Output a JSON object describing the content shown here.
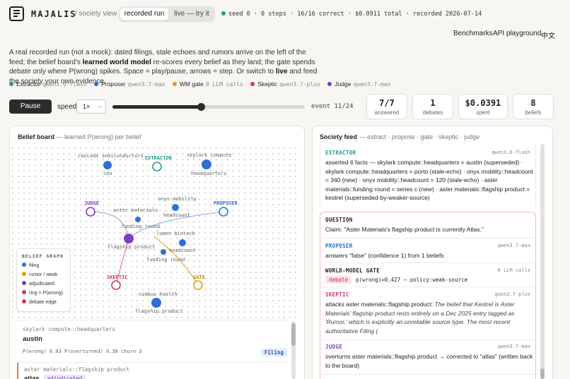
{
  "header": {
    "brand": "MAJALIS",
    "crumb": "/ society view",
    "mode_recorded": "recorded run",
    "mode_live": "live — try it",
    "status": "seed 0 · 0 steps · 16/16 correct · $0.0911 total · recorded 2026-07-14",
    "nav": [
      "Benchmarks",
      "API playground",
      "中文"
    ]
  },
  "intro": {
    "p1": "A real recorded run (not a mock): dated filings, stale echoes and rumors arrive on the left of the feed; the belief board's ",
    "b1": "learned world model",
    "p2": " re-scores every belief as they land; the gate spends debate only where P(wrong) spikes. Space = play/pause, arrows = step. Or switch to ",
    "b2": "live",
    "p3": " and feed the society your own evidence."
  },
  "agents": [
    {
      "name": "Extractor",
      "model": "qwen3.6-flash",
      "color": "#1f9e8f"
    },
    {
      "name": "Proposer",
      "model": "qwen3.7-max",
      "color": "#2f6fd6"
    },
    {
      "name": "WM gate",
      "model": "0 LLM calls",
      "color": "#e0a000"
    },
    {
      "name": "Skeptic",
      "model": "qwen3.7-plus",
      "color": "#d23b5a"
    },
    {
      "name": "Judge",
      "model": "qwen3.7-max",
      "color": "#7b3fc4"
    }
  ],
  "controls": {
    "pause_label": "Pause",
    "speed_label": "speed",
    "speed_value": "1×",
    "event_label": "event 11/24",
    "progress": 0.458
  },
  "stats": [
    {
      "value": "7/7",
      "label": "answered"
    },
    {
      "value": "1",
      "label": "debates"
    },
    {
      "value": "$0.0391",
      "label": "spent"
    },
    {
      "value": "8",
      "label": "beliefs"
    }
  ],
  "belief_board": {
    "title": "Belief board",
    "subtitle": "— learned P(wrong) per belief",
    "nodes": {
      "cascade": "cascade semiconductors",
      "ceo": "ceo",
      "extractor": "EXTRACTOR",
      "skylark": "skylark compute",
      "headquarters": "headquarters",
      "judge": "JUDGE",
      "onyx": "onyx mobility",
      "headcount1": "headcount",
      "proposer": "PROPOSER",
      "aster": "aster materials",
      "funding1": "funding round",
      "flagship1": "flagship product",
      "lumen": "lumen biotech",
      "headcount2": "headcount",
      "funding2": "funding round",
      "skeptic": "SKEPTIC",
      "gate": "GATE",
      "nimbus": "nimbus health",
      "flagship2": "flagship product"
    },
    "legend": {
      "title": "BELIEF GRAPH",
      "items": [
        {
          "label": "filing",
          "color": "#2f6fd6"
        },
        {
          "label": "rumor / weak",
          "color": "#e0a000"
        },
        {
          "label": "adjudicated",
          "color": "#7b3fc4"
        },
        {
          "label": "ring = P(wrong)",
          "color": "#d23b5a"
        },
        {
          "label": "debate edge",
          "color": "#d23b5a"
        }
      ]
    },
    "cards": [
      {
        "key": "skylark compute::headquarters",
        "value": "austin",
        "meta": "P(wrong) 0.03  P(overturned) 0.38  churn 3",
        "tag": "Filing"
      },
      {
        "key": "aster materials::flagship product",
        "value": "atlas",
        "tag": "adjudicated"
      }
    ]
  },
  "feed": {
    "title": "Society feed",
    "subtitle": "— extract · propose · gate · skeptic · judge",
    "entries": [
      {
        "who": "EXTRACTOR",
        "model": "qwen3.6-flash",
        "text": "asserted 6 facts — skylark compute::headquarters = austin (superseded) · skylark compute::headquarters = porto (stale-echo) · onyx mobility::headcount = 340 (new) · onyx mobility::headcount = 120 (stale-echo) · aster materials::funding round = series c (new) · aster materials::flagship product = kestrel (superseded-by-weaker-source)"
      },
      {
        "who": "QUESTION",
        "text": "Claim: \"Aster Materials's flagship product is currently Atlas.\""
      },
      {
        "who": "PROPOSER",
        "model": "qwen3.7-max",
        "text": "answers \"false\" (confidence 1) from 1 beliefs"
      },
      {
        "who": "WORLD-MODEL GATE",
        "model": "0 LLM calls",
        "badge": "debate",
        "text": "p(wrong)=0.427 — policy:weak-source"
      },
      {
        "who": "SKEPTIC",
        "model": "qwen3.7-plus",
        "text_plain": "attacks aster materials::flagship product: ",
        "text_italic": "The belief that Kestrel is Aster Materials' flagship product rests entirely on a Dec 2025 entry tagged as 'Rumor,' which is explicitly an unreliable source type. The most recent authoritative Filing ("
      },
      {
        "who": "JUDGE",
        "model": "qwen3.7-max",
        "text": "overturns aster materials::flagship product → corrected to \"atlas\" (written back to the board)"
      }
    ]
  }
}
